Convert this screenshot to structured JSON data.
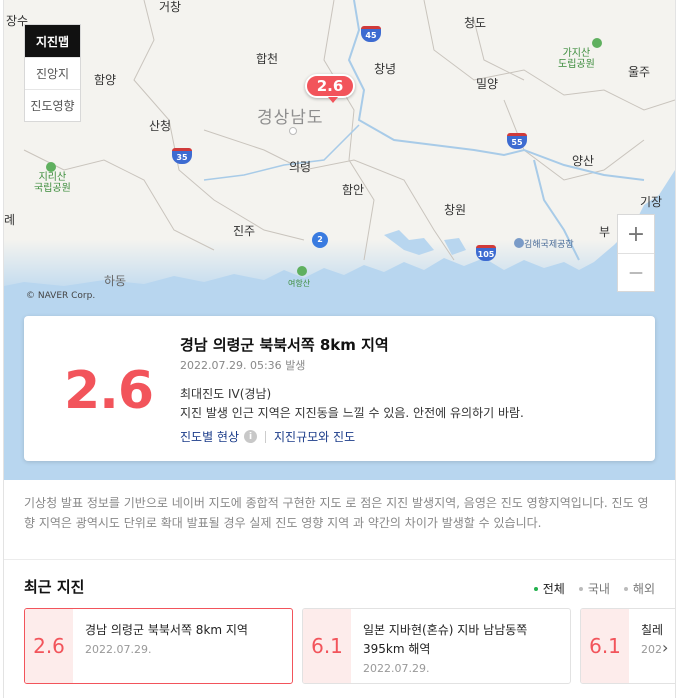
{
  "map": {
    "tabs": [
      "지진맵",
      "진앙지",
      "진도영향"
    ],
    "active_tab": 0,
    "marker_label": "2.6",
    "copyright": "© NAVER Corp.",
    "cities": {
      "jangsu": "장수",
      "geochang": "거창",
      "cheongdo": "청도",
      "hamyang": "함양",
      "hapcheon": "합천",
      "changnyeong": "창녕",
      "miryang": "밀양",
      "ulju": "울주",
      "gyeongsangnamdo": "경상남도",
      "sancheong": "산청",
      "uiryeong": "의령",
      "haman": "함안",
      "yangsan": "양산",
      "changwon": "창원",
      "jinju": "진주",
      "gijang": "기장",
      "busan_partial": "부",
      "gimhae_airport": "김해국제공항",
      "hadong": "하동",
      "gaji": "가지산\n도립공원",
      "jiri": "지리산\n국립공원",
      "left_edge": "례",
      "yeohangsan": "여항산"
    },
    "highways": {
      "h45": "45",
      "h35": "35",
      "h55": "55",
      "h105": "105",
      "r2": "2"
    },
    "zoom_in": "+",
    "zoom_out": "—"
  },
  "card": {
    "magnitude": "2.6",
    "title": "경남 의령군 북북서쪽 8km 지역",
    "time": "2022.07.29. 05:36",
    "time_suffix": "발생",
    "intensity": "최대진도 IV(경남)",
    "description": "지진 발생 인근 지역은 지진동을 느낄 수 있음. 안전에 유의하기 바람.",
    "link1": "진도별 현상",
    "link2": "지진규모와 진도",
    "info_glyph": "i"
  },
  "notice": "기상청 발표 정보를 기반으로 네이버 지도에 종합적 구현한 지도 로 점은 지진 발생지역, 음영은 진도 영향지역입니다. 진도 영향 지역은 광역시도 단위로 확대 발표될 경우 실제 진도 영향 지역 과 약간의 차이가 발생할 수 있습니다.",
  "recent": {
    "title": "최근 지진",
    "filters": [
      "전체",
      "국내",
      "해외"
    ],
    "active_filter": 0,
    "items": [
      {
        "mag": "2.6",
        "title": "경남 의령군 북북서쪽 8km 지역",
        "date": "2022.07.29."
      },
      {
        "mag": "6.1",
        "title": "일본 지바현(혼슈) 지바 남남동쪽 395km 해역",
        "date": "2022.07.29."
      },
      {
        "mag": "6.1",
        "title": "칠레 ",
        "date": "202"
      }
    ],
    "next_glyph": "›"
  },
  "colors": {
    "accent": "#f2545b",
    "link": "#1c3d8a",
    "filter_on": "#23b14d",
    "water": "#b8d6ef",
    "land": "#f4f3ef"
  }
}
